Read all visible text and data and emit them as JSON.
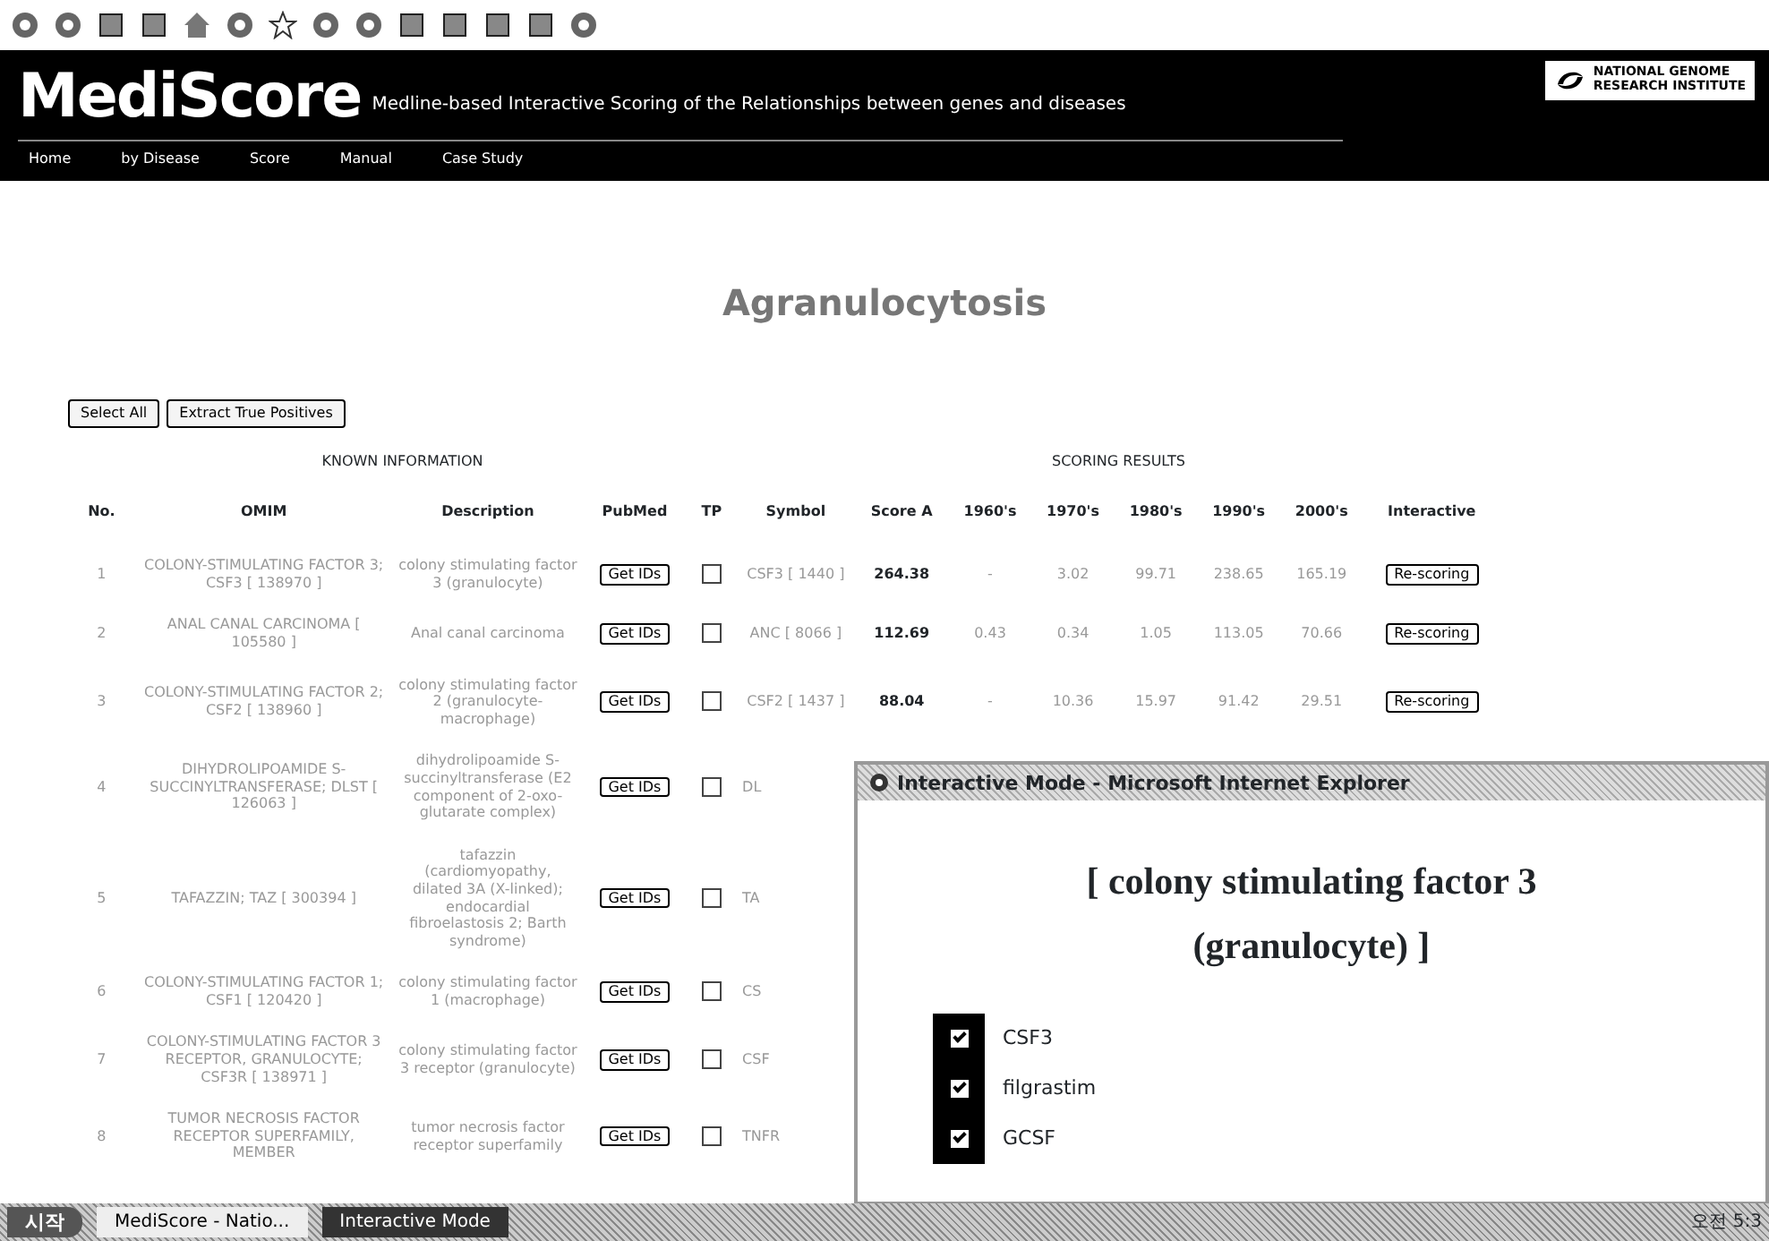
{
  "header": {
    "logo": "MediScore",
    "subtitle": "Medline-based Interactive Scoring of the Relationships between genes and diseases",
    "institute": [
      "NATIONAL GENOME",
      "RESEARCH INSTITUTE"
    ]
  },
  "nav": [
    {
      "label": "Home"
    },
    {
      "label": "by Disease"
    },
    {
      "label": "Score"
    },
    {
      "label": "Manual"
    },
    {
      "label": "Case Study"
    }
  ],
  "page_title": "Agranulocytosis",
  "actions": [
    "Select All",
    "Extract True Positives"
  ],
  "sections": [
    "KNOWN INFORMATION",
    "SCORING RESULTS"
  ],
  "table": {
    "columns": [
      "No.",
      "OMIM",
      "Description",
      "PubMed",
      "TP",
      "Symbol",
      "Score A",
      "1960's",
      "1970's",
      "1980's",
      "1990's",
      "2000's",
      "Interactive"
    ],
    "rows": [
      {
        "no": "1",
        "omim": "COLONY-STIMULATING FACTOR 3; CSF3 [ 138970 ]",
        "description": "colony stimulating factor 3 (granulocyte)",
        "pubmed": "Get IDs",
        "tp": false,
        "symbol": "CSF3 [ 1440 ]",
        "score": "264.38",
        "decades": [
          "-",
          "3.02",
          "99.71",
          "238.65",
          "165.19"
        ],
        "action": "Re-scoring"
      },
      {
        "no": "2",
        "omim": "ANAL CANAL CARCINOMA [ 105580 ]",
        "description": "Anal canal carcinoma",
        "pubmed": "Get IDs",
        "tp": false,
        "symbol": "ANC [ 8066 ]",
        "score": "112.69",
        "decades": [
          "0.43",
          "0.34",
          "1.05",
          "113.05",
          "70.66"
        ],
        "action": "Re-scoring"
      },
      {
        "no": "3",
        "omim": "COLONY-STIMULATING FACTOR 2; CSF2 [ 138960 ]",
        "description": "colony stimulating factor 2 (granulocyte-macrophage)",
        "pubmed": "Get IDs",
        "tp": false,
        "symbol": "CSF2 [ 1437 ]",
        "score": "88.04",
        "decades": [
          "-",
          "10.36",
          "15.97",
          "91.42",
          "29.51"
        ],
        "action": "Re-scoring"
      },
      {
        "no": "4",
        "omim": "DIHYDROLIPOAMIDE S-SUCCINYLTRANSFERASE; DLST [ 126063 ]",
        "description": "dihydrolipoamide S-succinyltransferase (E2 component of 2-oxo-glutarate complex)",
        "pubmed": "Get IDs",
        "tp": false,
        "symbol": "DL"
      },
      {
        "no": "5",
        "omim": "TAFAZZIN; TAZ [ 300394 ]",
        "description": "tafazzin (cardiomyopathy, dilated 3A (X-linked); endocardial fibroelastosis 2; Barth syndrome)",
        "pubmed": "Get IDs",
        "tp": false,
        "symbol": "TA"
      },
      {
        "no": "6",
        "omim": "COLONY-STIMULATING FACTOR 1; CSF1 [ 120420 ]",
        "description": "colony stimulating factor 1 (macrophage)",
        "pubmed": "Get IDs",
        "tp": false,
        "symbol": "CS"
      },
      {
        "no": "7",
        "omim": "COLONY-STIMULATING FACTOR 3 RECEPTOR, GRANULOCYTE; CSF3R [ 138971 ]",
        "description": "colony stimulating factor 3 receptor (granulocyte)",
        "pubmed": "Get IDs",
        "tp": false,
        "symbol": "CSF"
      },
      {
        "no": "8",
        "omim": "TUMOR NECROSIS FACTOR RECEPTOR SUPERFAMILY, MEMBER",
        "description": "tumor necrosis factor receptor superfamily",
        "pubmed": "Get IDs",
        "tp": false,
        "symbol": "TNFR"
      }
    ]
  },
  "popup": {
    "title": "Interactive Mode - Microsoft Internet Explorer",
    "heading": "[ colony stimulating factor 3 (granulocyte) ]",
    "terms": [
      {
        "label": "CSF3",
        "checked": true
      },
      {
        "label": "filgrastim",
        "checked": true
      },
      {
        "label": "GCSF",
        "checked": true
      }
    ]
  },
  "taskbar": {
    "start": "시작",
    "tasks": [
      {
        "label": "MediScore - Natio...",
        "selected": false
      },
      {
        "label": "Interactive Mode",
        "selected": true
      }
    ],
    "clock": "오전 5:3"
  }
}
